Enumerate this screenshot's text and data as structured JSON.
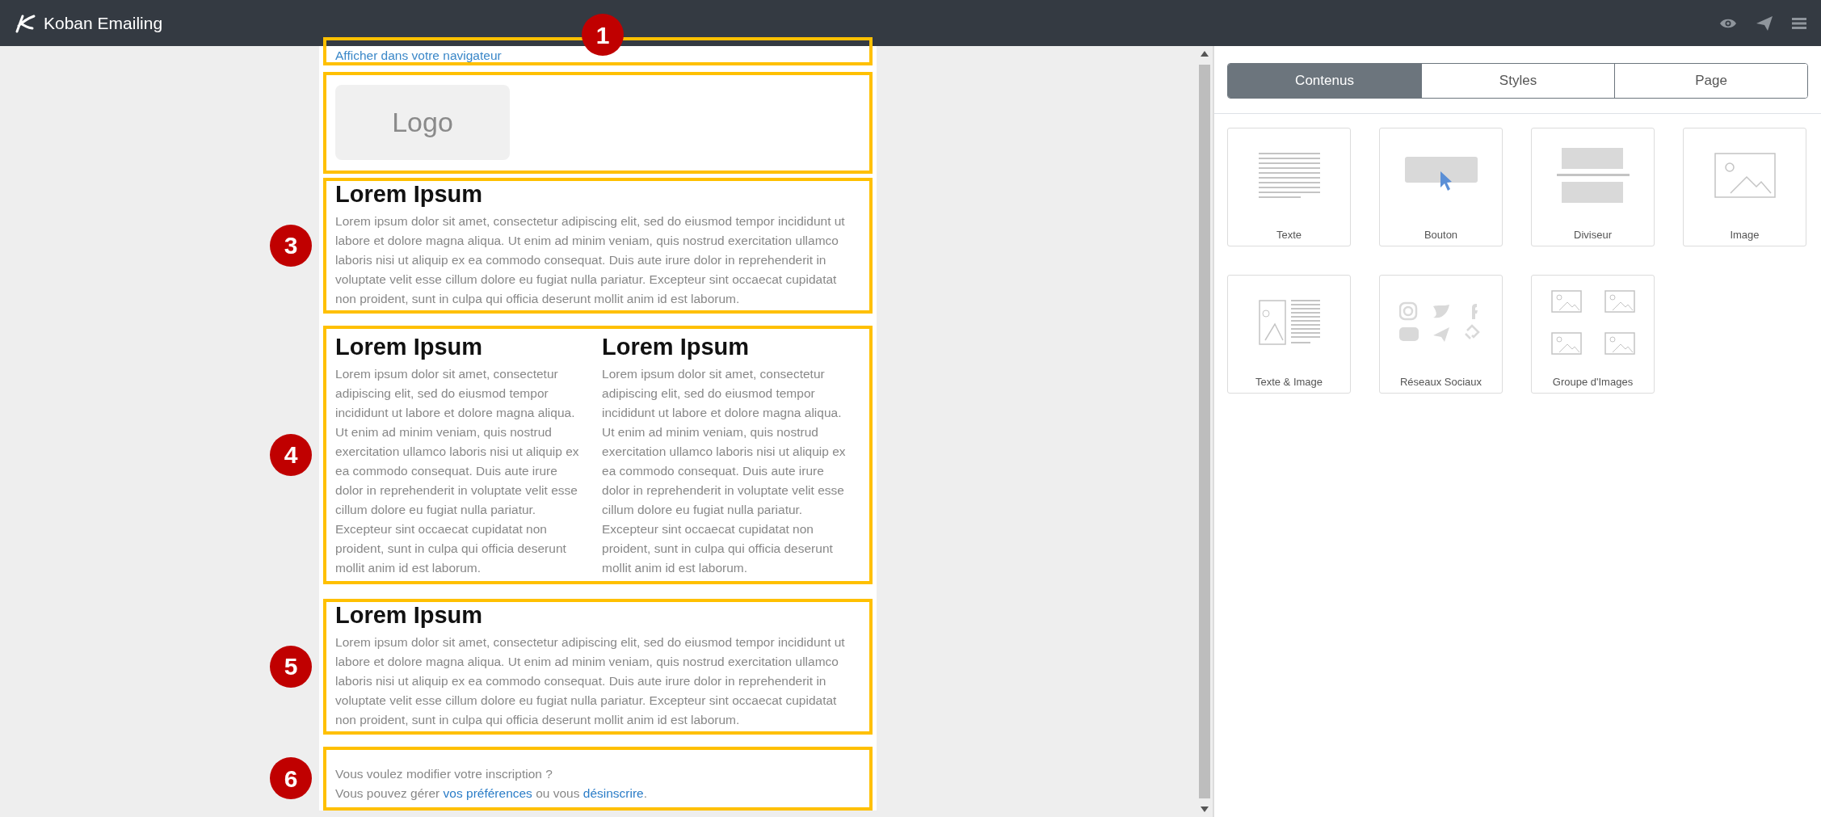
{
  "app": {
    "title": "Koban Emailing"
  },
  "email": {
    "sections": [
      {
        "kind": "link_bar",
        "marker": "1",
        "link": "Afficher dans votre navigateur"
      },
      {
        "kind": "logo",
        "logo": "Logo"
      },
      {
        "kind": "text",
        "marker": "3",
        "heading": "Lorem Ipsum",
        "body": "Lorem ipsum dolor sit amet, consectetur adipiscing elit, sed do eiusmod tempor incididunt ut labore et dolore magna aliqua. Ut enim ad minim veniam, quis nostrud exercitation ullamco laboris nisi ut aliquip ex ea commodo consequat. Duis aute irure dolor in reprehenderit in voluptate velit esse cillum dolore eu fugiat nulla pariatur. Excepteur sint occaecat cupidatat non proident, sunt in culpa qui officia deserunt mollit anim id est laborum."
      },
      {
        "kind": "two_columns",
        "marker": "4",
        "columns": [
          {
            "heading": "Lorem Ipsum",
            "body": "Lorem ipsum dolor sit amet, consectetur adipiscing elit, sed do eiusmod tempor incididunt ut labore et dolore magna aliqua. Ut enim ad minim veniam, quis nostrud exercitation ullamco laboris nisi ut aliquip ex ea commodo consequat. Duis aute irure dolor in reprehenderit in voluptate velit esse cillum dolore eu fugiat nulla pariatur. Excepteur sint occaecat cupidatat non proident, sunt in culpa qui officia deserunt mollit anim id est laborum."
          },
          {
            "heading": "Lorem Ipsum",
            "body": "Lorem ipsum dolor sit amet, consectetur adipiscing elit, sed do eiusmod tempor incididunt ut labore et dolore magna aliqua. Ut enim ad minim veniam, quis nostrud exercitation ullamco laboris nisi ut aliquip ex ea commodo consequat. Duis aute irure dolor in reprehenderit in voluptate velit esse cillum dolore eu fugiat nulla pariatur. Excepteur sint occaecat cupidatat non proident, sunt in culpa qui officia deserunt mollit anim id est laborum."
          }
        ]
      },
      {
        "kind": "text",
        "marker": "5",
        "heading": "Lorem Ipsum",
        "body": "Lorem ipsum dolor sit amet, consectetur adipiscing elit, sed do eiusmod tempor incididunt ut labore et dolore magna aliqua. Ut enim ad minim veniam, quis nostrud exercitation ullamco laboris nisi ut aliquip ex ea commodo consequat. Duis aute irure dolor in reprehenderit in voluptate velit esse cillum dolore eu fugiat nulla pariatur. Excepteur sint occaecat cupidatat non proident, sunt in culpa qui officia deserunt mollit anim id est laborum."
      },
      {
        "kind": "footer",
        "marker": "6",
        "line": "Vous voulez modifier votre inscription ?",
        "parts": [
          {
            "kind": "text",
            "text": "Vous pouvez gérer "
          },
          {
            "kind": "link",
            "text": "vos préférences"
          },
          {
            "kind": "text",
            "text": " ou vous "
          },
          {
            "kind": "link",
            "text": "désinscrire"
          },
          {
            "kind": "text",
            "text": "."
          }
        ]
      }
    ]
  },
  "panel": {
    "tabs": [
      {
        "label": "Contenus",
        "selected": true
      },
      {
        "label": "Styles",
        "selected": false
      },
      {
        "label": "Page",
        "selected": false
      }
    ],
    "blocks": [
      {
        "kind": "text",
        "label": "Texte"
      },
      {
        "kind": "button",
        "label": "Bouton"
      },
      {
        "kind": "divider",
        "label": "Diviseur"
      },
      {
        "kind": "image",
        "label": "Image"
      },
      {
        "kind": "text_image",
        "label": "Texte & Image"
      },
      {
        "kind": "social",
        "label": "Réseaux Sociaux"
      },
      {
        "kind": "image_group",
        "label": "Groupe d'Images"
      }
    ]
  }
}
